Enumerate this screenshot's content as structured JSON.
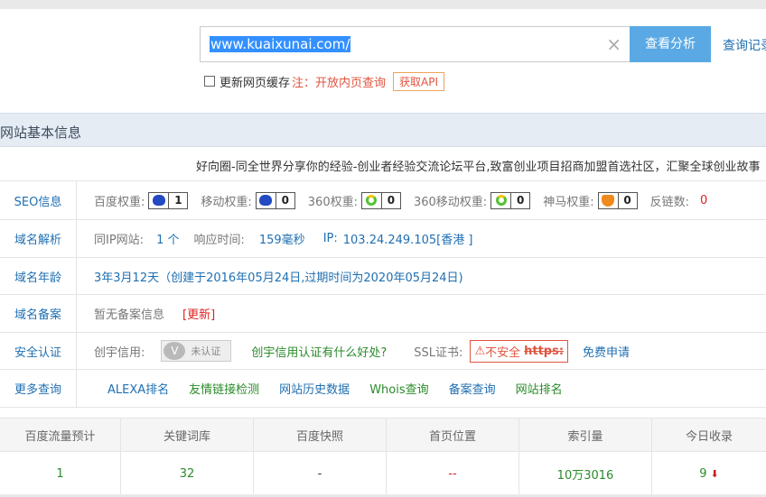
{
  "search": {
    "value": "www.kuaixunai.com/",
    "clear_icon": "×",
    "button_label": "查看分析",
    "history_label": "查询记录"
  },
  "options": {
    "cache_label": "更新网页缓存",
    "note": "注：开放内页查询",
    "api_label": "获取API"
  },
  "section": {
    "title": "网站基本信息",
    "site_title": "好向圈-同全世界分享你的经验-创业者经验交流论坛平台,致富创业项目招商加盟首选社区，汇聚全球创业故事"
  },
  "rows": {
    "seo": {
      "label": "SEO信息",
      "baidu_label": "百度权重:",
      "baidu_value": "1",
      "mobile_label": "移动权重:",
      "mobile_value": "0",
      "s360_label": "360权重:",
      "s360_value": "0",
      "s360m_label": "360移动权重:",
      "s360m_value": "0",
      "shenma_label": "神马权重:",
      "shenma_value": "0",
      "backlink_label": "反链数:",
      "backlink_value": "0"
    },
    "dns": {
      "label": "域名解析",
      "sameip_label": "同IP网站:",
      "sameip_value": "1 个",
      "resp_label": "响应时间:",
      "resp_value": "159毫秒",
      "ip_label": "IP:",
      "ip_value": "103.24.249.105[香港 ]"
    },
    "age": {
      "label": "域名年龄",
      "value": "3年3月12天（创建于2016年05月24日,过期时间为2020年05月24日)"
    },
    "icp": {
      "label": "域名备案",
      "value": "暂无备案信息",
      "update": "[更新]"
    },
    "security": {
      "label": "安全认证",
      "credit_label": "创宇信用:",
      "credit_badge": "未认证",
      "credit_link": "创宇信用认证有什么好处?",
      "ssl_label": "SSL证书:",
      "unsafe_label": "不安全",
      "https_label": "https:",
      "apply_link": "免费申请"
    },
    "more": {
      "label": "更多查询",
      "links": [
        "ALEXA排名",
        "友情链接检测",
        "网站历史数据",
        "Whois查询",
        "备案查询",
        "网站排名"
      ]
    }
  },
  "stats": {
    "headers": [
      "百度流量预计",
      "关键词库",
      "百度快照",
      "首页位置",
      "索引量",
      "今日收录"
    ],
    "values": [
      "1",
      "32",
      "-",
      "--",
      "10万3016",
      "9"
    ]
  },
  "colors": {
    "accent": "#5aa9e4",
    "link": "#1f6fb2",
    "warn": "#e0543f",
    "green": "#2a8a2a"
  }
}
